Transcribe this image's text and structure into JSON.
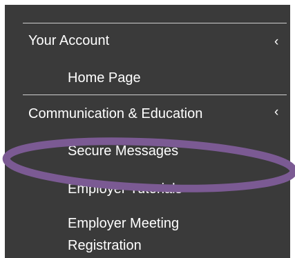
{
  "menu": {
    "sections": [
      {
        "label": "Your Account",
        "expand_icon": "chevron-left-icon",
        "items": [
          {
            "label": "Home Page"
          }
        ]
      },
      {
        "label": "Communication & Education",
        "expand_icon": "chevron-left-icon",
        "items": [
          {
            "label": "Secure Messages"
          },
          {
            "label": "Employer Tutorials"
          },
          {
            "label": "Employer Meeting Registration"
          }
        ]
      }
    ]
  },
  "colors": {
    "menu_background": "#3a3a3a",
    "divider": "#cfcfcf",
    "text": "#ffffff",
    "highlight_ellipse": "#7b5a93"
  },
  "glyphs": {
    "chevron": "‹"
  }
}
